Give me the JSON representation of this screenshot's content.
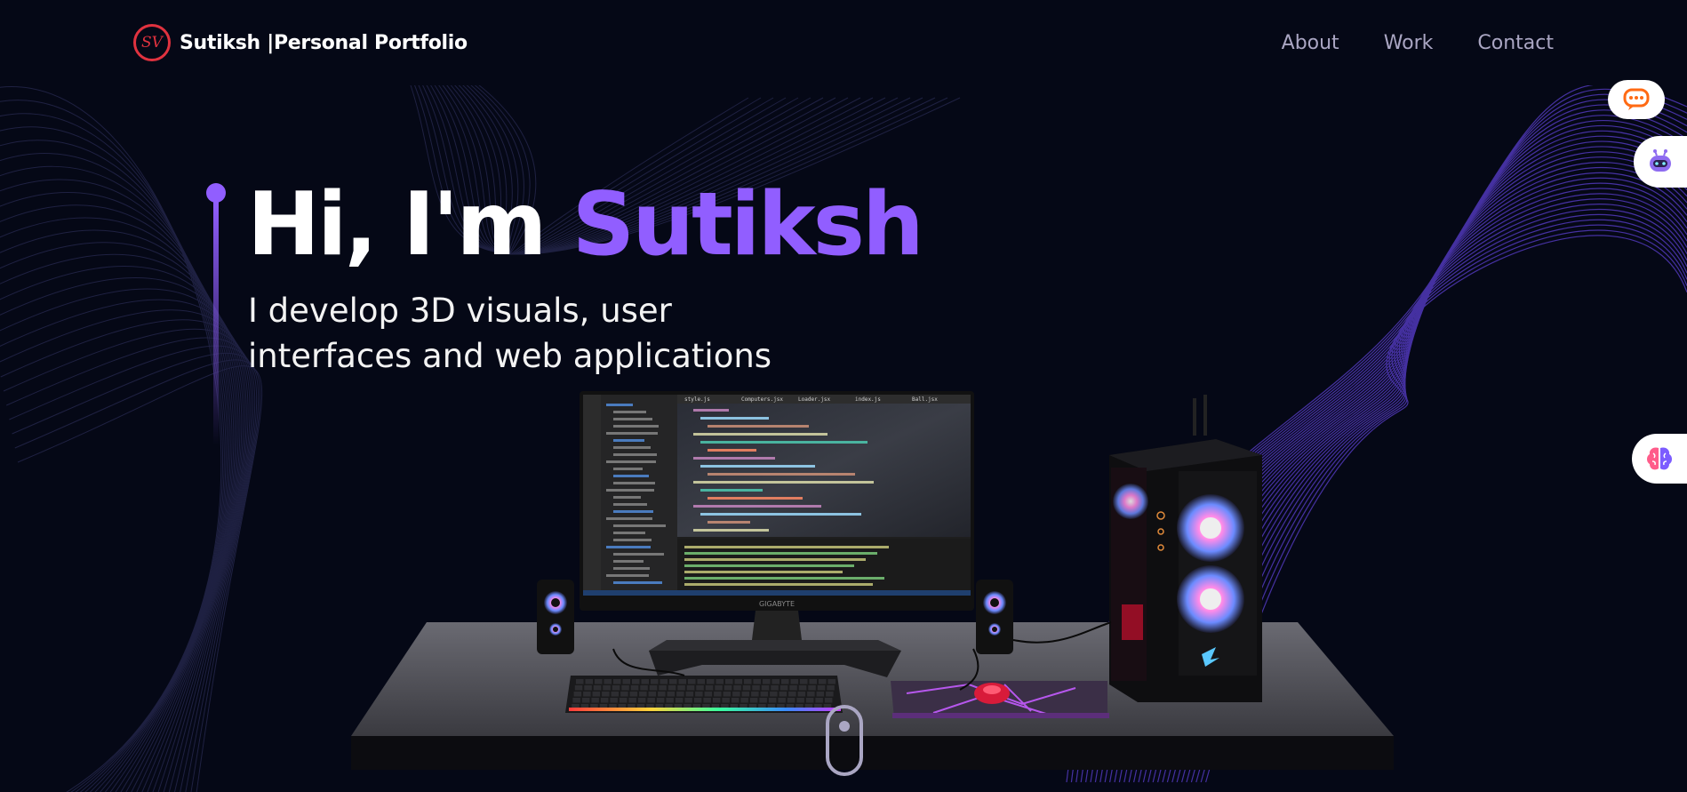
{
  "nav": {
    "brand_logo_text": "SV",
    "brand_text": "Sutiksh |Personal Portfolio",
    "links": [
      "About",
      "Work",
      "Contact"
    ]
  },
  "hero": {
    "greeting": "Hi, I'm ",
    "name": "Sutiksh",
    "subtitle_line1": "I develop 3D visuals, user",
    "subtitle_line2": "interfaces and web applications"
  },
  "widgets": {
    "chat_icon": "chat-bubble-icon",
    "bot_icon": "robot-icon",
    "brain_icon": "brain-icon"
  },
  "scene": {
    "monitor_brand": "GIGABYTE",
    "editor_tabs": [
      "style.js",
      "Computers.jsx",
      "Loader.jsx",
      "index.js",
      "Ball.jsx"
    ]
  },
  "colors": {
    "background": "#050816",
    "accent": "#915eff",
    "nav_link": "#aaa6c3",
    "logo": "#e0323f"
  }
}
